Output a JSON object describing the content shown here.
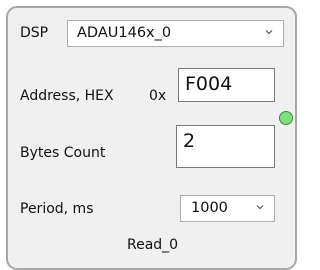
{
  "dsp": {
    "label": "DSP",
    "selected": "ADAU146x_0",
    "chevron_icon": "chevron-down-icon"
  },
  "address": {
    "label": "Address, HEX",
    "prefix": "0x",
    "value": "F004"
  },
  "bytes_count": {
    "label": "Bytes Count",
    "value": "2"
  },
  "period": {
    "label": "Period, ms",
    "selected": "1000",
    "chevron_icon": "chevron-down-icon"
  },
  "status": {
    "indicator_color": "#7ddf7d",
    "indicator_icon": "status-led-icon"
  },
  "footer": {
    "label": "Read_0"
  }
}
